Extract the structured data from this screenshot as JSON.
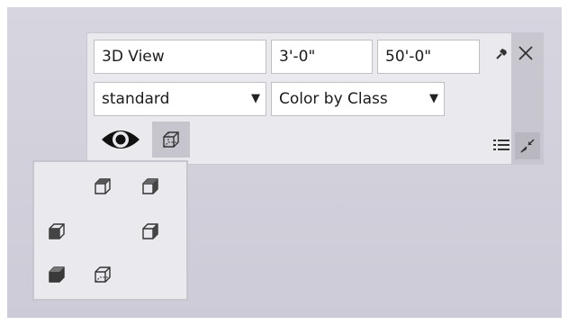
{
  "palette": {
    "view_name": "3D View",
    "height_value": "3'-0\"",
    "distance_value": "50'-0\"",
    "render_mode": "standard",
    "color_mode": "Color by Class"
  },
  "icons": {
    "pin": "pin-icon",
    "close": "close-icon",
    "eye": "eye-icon",
    "cube": "cube-view-icon",
    "list": "list-icon",
    "collapse": "collapse-icon"
  },
  "popup": {
    "views": [
      "top-front-left",
      "top-front-right",
      "left",
      "right",
      "bottom-left",
      "bottom-right"
    ]
  },
  "colors": {
    "canvas": "#d3d1dc",
    "panel": "#e9e9ee",
    "side_strip": "#c8c7cf",
    "highlight": "#c6c5cd"
  }
}
